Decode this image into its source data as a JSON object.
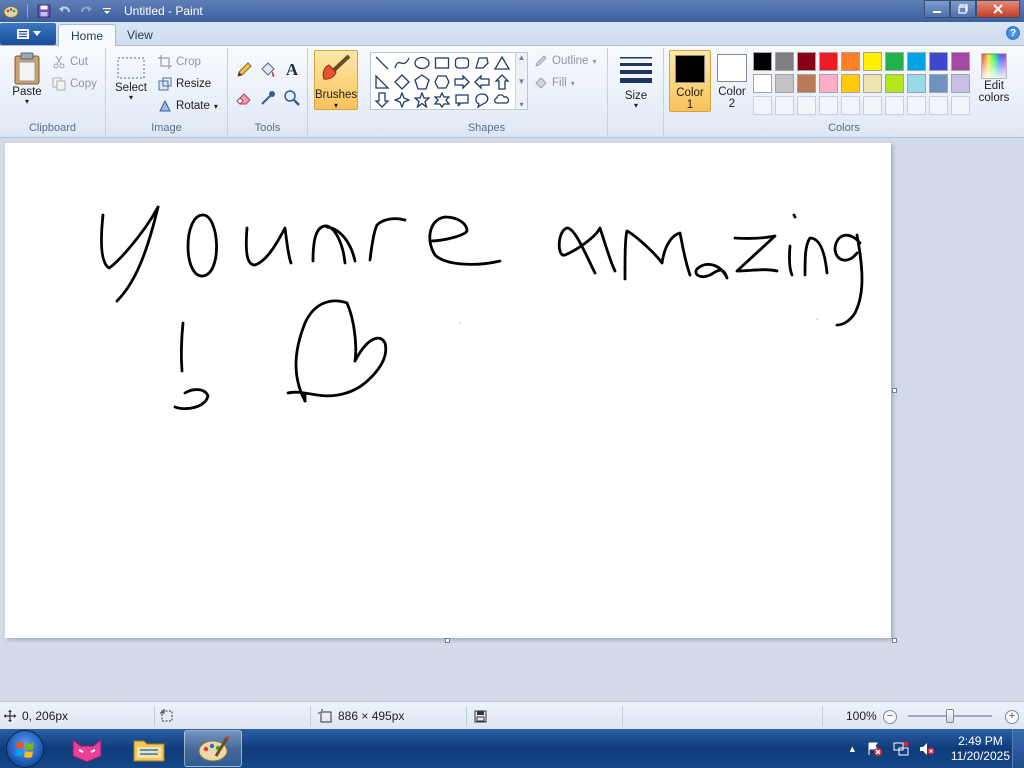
{
  "window": {
    "title": "Untitled - Paint"
  },
  "tabs": [
    {
      "label": "Home"
    },
    {
      "label": "View"
    }
  ],
  "ribbon": {
    "clipboard": {
      "label": "Clipboard",
      "paste": "Paste",
      "cut": "Cut",
      "copy": "Copy"
    },
    "image": {
      "label": "Image",
      "select": "Select",
      "crop": "Crop",
      "resize": "Resize",
      "rotate": "Rotate"
    },
    "tools": {
      "label": "Tools"
    },
    "brushes": {
      "label": "Brushes"
    },
    "shapes": {
      "label": "Shapes",
      "outline": "Outline",
      "fill": "Fill"
    },
    "size": {
      "label": "Size"
    },
    "colors": {
      "label": "Colors",
      "color1_line1": "Color",
      "color1_line2": "1",
      "color2_line1": "Color",
      "color2_line2": "2",
      "edit_line1": "Edit",
      "edit_line2": "colors",
      "color1_value": "#000000",
      "color2_value": "#ffffff",
      "palette_row1": [
        "#000000",
        "#7f7f7f",
        "#880015",
        "#ed1c24",
        "#ff7f27",
        "#fff200",
        "#22b14c",
        "#00a2e8",
        "#3f48cc",
        "#a349a4"
      ],
      "palette_row2": [
        "#ffffff",
        "#c3c3c3",
        "#b97a57",
        "#ffaec9",
        "#ffc90e",
        "#efe4b0",
        "#b5e61d",
        "#99d9ea",
        "#7092be",
        "#c8bfe7"
      ]
    }
  },
  "status": {
    "cursor_pos": "0, 206px",
    "canvas_size": "886 × 495px",
    "zoom": "100%",
    "zoom_minus": "−",
    "zoom_plus": "+"
  },
  "taskbar": {
    "time": "2:49 PM",
    "date": "11/20/2025"
  }
}
